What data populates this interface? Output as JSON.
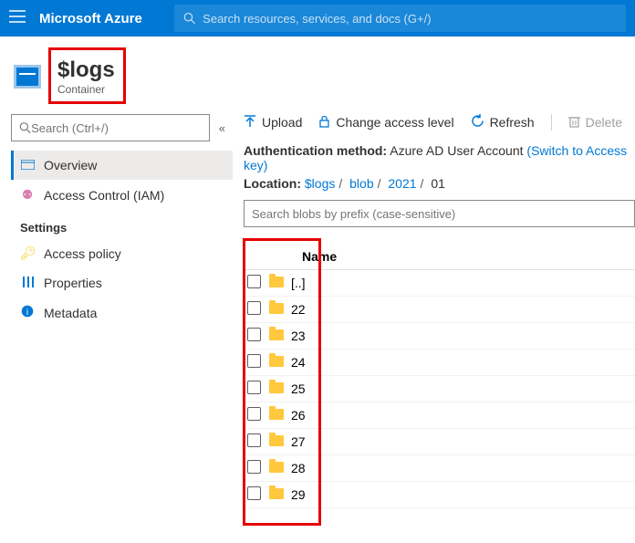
{
  "topbar": {
    "brand": "Microsoft Azure",
    "search_placeholder": "Search resources, services, and docs (G+/)"
  },
  "header": {
    "title": "$logs",
    "subtitle": "Container"
  },
  "sidebar": {
    "search_placeholder": "Search (Ctrl+/)",
    "items": [
      {
        "label": "Overview"
      },
      {
        "label": "Access Control (IAM)"
      }
    ],
    "settings_label": "Settings",
    "settings_items": [
      {
        "label": "Access policy"
      },
      {
        "label": "Properties"
      },
      {
        "label": "Metadata"
      }
    ]
  },
  "toolbar": {
    "upload": "Upload",
    "access": "Change access level",
    "refresh": "Refresh",
    "delete": "Delete"
  },
  "meta": {
    "auth_label": "Authentication method:",
    "auth_value": "Azure AD User Account",
    "auth_switch": "(Switch to Access key)",
    "loc_label": "Location:",
    "crumbs": [
      "$logs",
      "blob",
      "2021",
      "01"
    ]
  },
  "blob_search_placeholder": "Search blobs by prefix (case-sensitive)",
  "table": {
    "header_name": "Name",
    "rows": [
      {
        "name": "[..]"
      },
      {
        "name": "22"
      },
      {
        "name": "23"
      },
      {
        "name": "24"
      },
      {
        "name": "25"
      },
      {
        "name": "26"
      },
      {
        "name": "27"
      },
      {
        "name": "28"
      },
      {
        "name": "29"
      }
    ]
  }
}
